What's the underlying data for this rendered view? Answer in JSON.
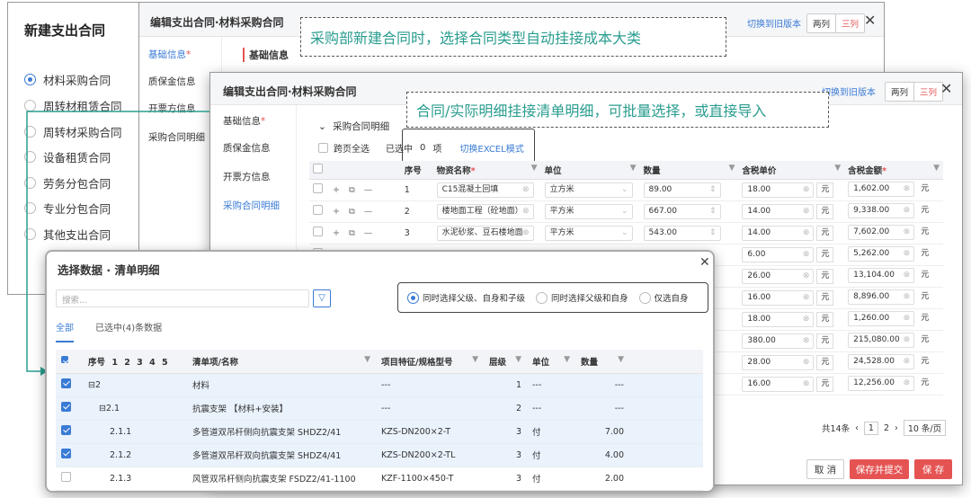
{
  "left_panel": {
    "title": "新建支出合同",
    "options": [
      {
        "label": "材料采购合同",
        "selected": true
      },
      {
        "label": "周转材租赁合同",
        "selected": false
      },
      {
        "label": "周转材采购合同",
        "selected": false
      },
      {
        "label": "设备租赁合同",
        "selected": false
      },
      {
        "label": "劳务分包合同",
        "selected": false
      },
      {
        "label": "专业分包合同",
        "selected": false
      },
      {
        "label": "其他支出合同",
        "selected": false
      }
    ]
  },
  "dialog1": {
    "title": "编辑支出合同·材料采购合同",
    "switch_link": "切换到旧版本",
    "seg_two": "两列",
    "seg_three": "三列",
    "close": "✕",
    "nav": [
      "基础信息",
      "质保金信息",
      "开票方信息",
      "采购合同明细"
    ],
    "section_title": "基础信息"
  },
  "callout1": "采购部新建合同时，选择合同类型自动挂接成本大类",
  "callout2": "合同/实际明细挂接清单明细，可批量选择，或直接导入",
  "dialog2": {
    "title": "编辑支出合同·材料采购合同",
    "switch_link": "切换到旧版本",
    "seg_two": "两列",
    "seg_three": "三列",
    "close": "✕",
    "nav": [
      "基础信息",
      "质保金信息",
      "开票方信息",
      "采购合同明细"
    ],
    "section_title": "采购合同明细",
    "cross_page_select": "跨页全选",
    "selected_label": "已选中",
    "selected_count": "0",
    "selected_unit": "项",
    "excel_mode": "切换EXCEL模式",
    "columns": {
      "seq": "序号",
      "name": "物资名称",
      "unit": "单位",
      "qty": "数量",
      "unit_price": "含税单价",
      "amount": "含税金额"
    },
    "currency": "元",
    "rows": [
      {
        "seq": "1",
        "name": "C15混凝土回填",
        "unit": "立方米",
        "qty": "89.00",
        "price": "18.00",
        "amount": "1,602.00"
      },
      {
        "seq": "2",
        "name": "楼地面工程（砼地面）",
        "unit": "平方米",
        "qty": "667.00",
        "price": "14.00",
        "amount": "9,338.00"
      },
      {
        "seq": "3",
        "name": "水泥砂浆、豆石楼地面",
        "unit": "平方米",
        "qty": "543.00",
        "price": "14.00",
        "amount": "7,602.00"
      },
      {
        "seq": "",
        "name": "",
        "unit": "",
        "qty": "",
        "price": "6.00",
        "amount": "5,262.00"
      },
      {
        "seq": "",
        "name": "",
        "unit": "",
        "qty": "",
        "price": "26.00",
        "amount": "13,104.00"
      },
      {
        "seq": "",
        "name": "",
        "unit": "",
        "qty": "",
        "price": "16.00",
        "amount": "8,896.00"
      },
      {
        "seq": "",
        "name": "",
        "unit": "",
        "qty": "",
        "price": "18.00",
        "amount": "1,260.00"
      },
      {
        "seq": "",
        "name": "",
        "unit": "",
        "qty": "",
        "price": "380.00",
        "amount": "215,080.00"
      },
      {
        "seq": "",
        "name": "",
        "unit": "",
        "qty": "",
        "price": "28.00",
        "amount": "24,528.00"
      },
      {
        "seq": "",
        "name": "",
        "unit": "",
        "qty": "",
        "price": "16.00",
        "amount": "12,256.00"
      }
    ],
    "pagination": {
      "total": "共14条",
      "prev": "‹",
      "page1": "1",
      "page2": "2",
      "next": "›",
      "per_page": "10 条/页"
    },
    "buttons": {
      "cancel": "取 消",
      "save_submit": "保存并提交",
      "save": "保 存"
    }
  },
  "dialog3": {
    "title": "选择数据 · 清单明细",
    "close": "✕",
    "search_placeholder": "搜索...",
    "radio_options": [
      {
        "label": "同时选择父级、自身和子级",
        "selected": true
      },
      {
        "label": "同时选择父级和自身",
        "selected": false
      },
      {
        "label": "仅选自身",
        "selected": false
      }
    ],
    "tabs": {
      "all": "全部",
      "selected": "已选中(4)条数据"
    },
    "columns": {
      "seq": "序号",
      "levels": "1 2 3 4 5",
      "name": "清单项/名称",
      "spec": "项目特征/规格型号",
      "level": "层级",
      "unit": "单位",
      "qty": "数量"
    },
    "rows": [
      {
        "checked": true,
        "seq": "⊟2",
        "name": "材料",
        "spec": "---",
        "level": "1",
        "unit": "---",
        "qty": "---",
        "indent": 0
      },
      {
        "checked": true,
        "seq": "⊟2.1",
        "name": "抗震支架 【材料+安装】",
        "spec": "---",
        "level": "2",
        "unit": "---",
        "qty": "---",
        "indent": 1
      },
      {
        "checked": true,
        "seq": "2.1.1",
        "name": "多管道双吊杆侧向抗震支架 SHDZ2/41",
        "spec": "KZS-DN200×2-T",
        "level": "3",
        "unit": "付",
        "qty": "7.00",
        "indent": 2
      },
      {
        "checked": true,
        "seq": "2.1.2",
        "name": "多管道双吊杆双向抗震支架 SHDZ4/41",
        "spec": "KZS-DN200×2-TL",
        "level": "3",
        "unit": "付",
        "qty": "4.00",
        "indent": 2
      },
      {
        "checked": false,
        "seq": "2.1.3",
        "name": "风管双吊杆侧向抗震支架 FSDZ2/41-1100",
        "spec": "KZF-1100×450-T",
        "level": "3",
        "unit": "付",
        "qty": "2.00",
        "indent": 2
      }
    ]
  },
  "colors": {
    "accent": "#3a7bd5",
    "danger": "#e55353",
    "callout_text": "#2a9d8f",
    "connector": "#2a9d8f"
  }
}
